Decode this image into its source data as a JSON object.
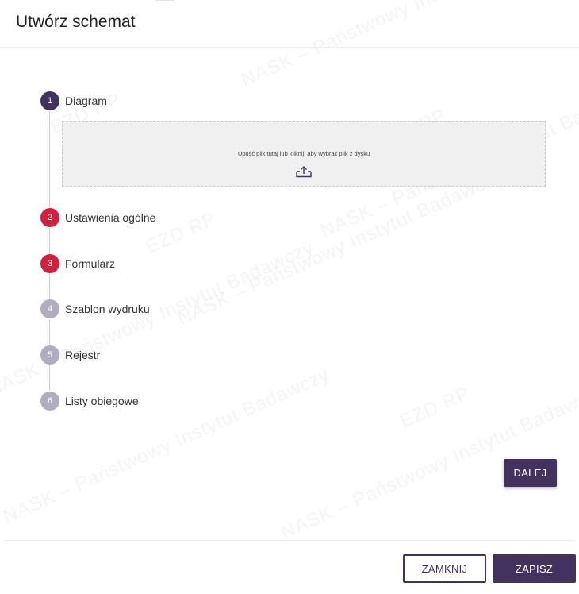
{
  "dialog": {
    "title": "Utwórz schemat"
  },
  "watermark": {
    "text": "NASK – Państwowy Instytut Badawczy",
    "logo": "EZD RP"
  },
  "steps": [
    {
      "number": "1",
      "label": "Diagram",
      "state": "active"
    },
    {
      "number": "2",
      "label": "Ustawienia ogólne",
      "state": "error"
    },
    {
      "number": "3",
      "label": "Formularz",
      "state": "error"
    },
    {
      "number": "4",
      "label": "Szablon wydruku",
      "state": "idle"
    },
    {
      "number": "5",
      "label": "Rejestr",
      "state": "idle"
    },
    {
      "number": "6",
      "label": "Listy obiegowe",
      "state": "idle"
    }
  ],
  "dropzone": {
    "text": "Upuść plik tutaj lub kliknij, aby wybrać plik z dysku",
    "icon": "upload-icon"
  },
  "buttons": {
    "next": "DALEJ",
    "close": "ZAMKNIJ",
    "save": "ZAPISZ"
  },
  "colors": {
    "primary": "#44325e",
    "error": "#d41f3f",
    "idle": "#b1acbf"
  }
}
